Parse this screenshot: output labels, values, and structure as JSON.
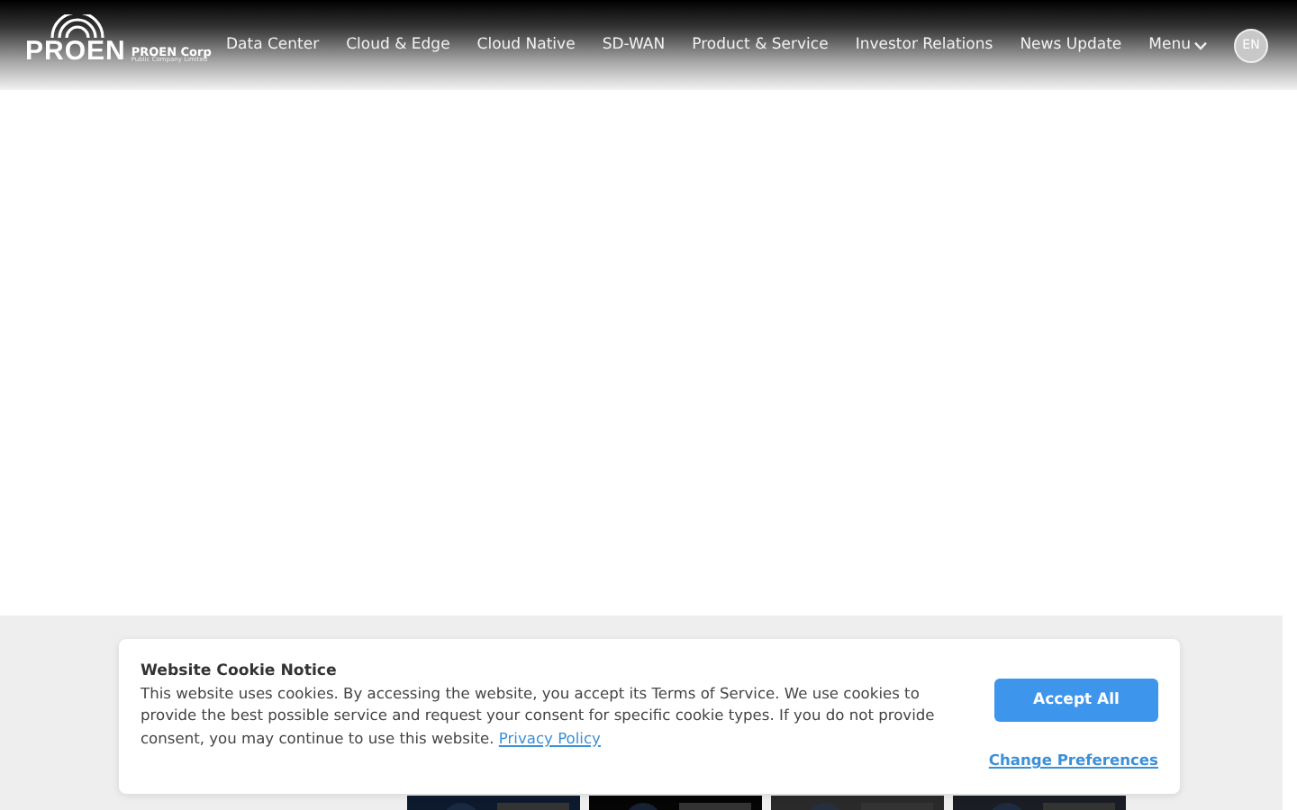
{
  "logo": {
    "mark": "PROEN",
    "name": "PROEN Corp",
    "tagline": "Public Company Limited"
  },
  "nav": [
    {
      "label": "Data Center"
    },
    {
      "label": "Cloud & Edge"
    },
    {
      "label": "Cloud Native"
    },
    {
      "label": "SD-WAN"
    },
    {
      "label": "Product & Service"
    },
    {
      "label": "Investor Relations"
    },
    {
      "label": "News Update"
    },
    {
      "label": "Menu",
      "kind": "dropdown"
    }
  ],
  "language": "EN",
  "cookie_notice": {
    "title": "Website Cookie Notice",
    "text": "This website uses cookies. By accessing the website, you accept its Terms of Service. We use cookies to provide the best possible service and request your consent for specific cookie types. If you do not provide consent, you may continue to use this website.",
    "link": "Privacy Policy",
    "accept": "Accept All",
    "preferences": "Change Preferences"
  }
}
